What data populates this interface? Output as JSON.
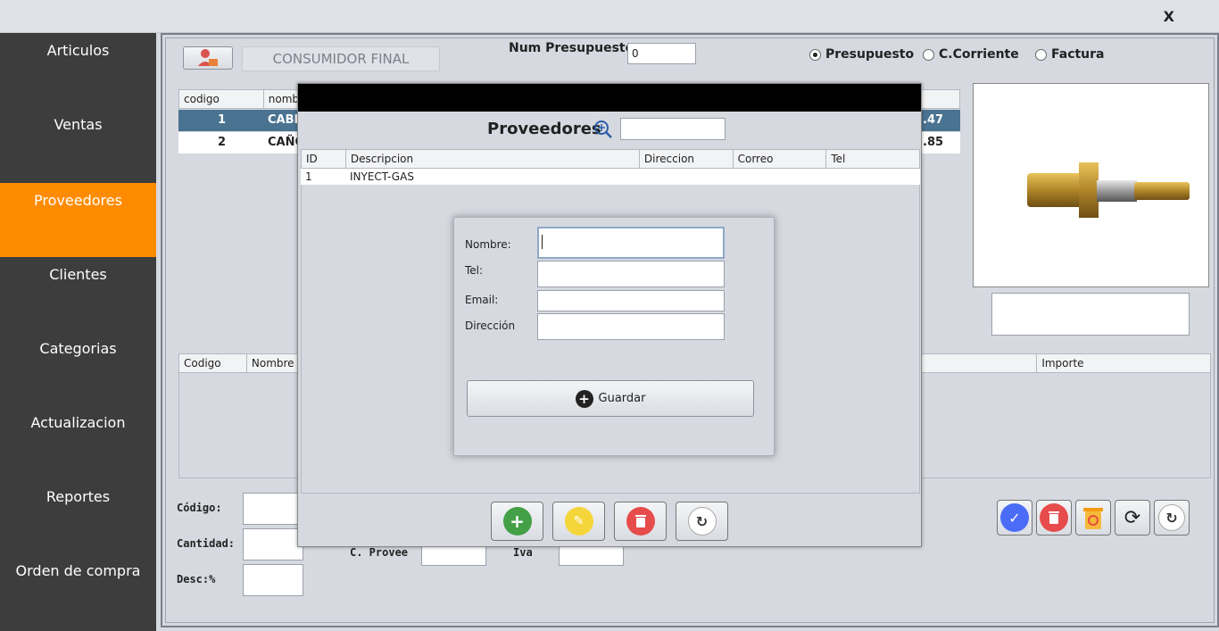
{
  "window": {
    "close_label": "X"
  },
  "sidebar": {
    "items": [
      {
        "label": "Articulos",
        "active": false
      },
      {
        "label": "Ventas",
        "active": false
      },
      {
        "label": "Proveedores",
        "active": true
      },
      {
        "label": "Clientes",
        "active": false
      },
      {
        "label": "Categorias",
        "active": false
      },
      {
        "label": "Actualizacion",
        "active": false
      },
      {
        "label": "Reportes",
        "active": false
      },
      {
        "label": "Orden de compra",
        "active": false
      }
    ],
    "active_color": "#ff8c00"
  },
  "header": {
    "customer_name": "CONSUMIDOR FINAL",
    "num_presupuesto_label": "Num Presupuesto",
    "num_presupuesto_value": "0",
    "doc_types": [
      {
        "label": "Presupuesto",
        "selected": true
      },
      {
        "label": "C.Corriente",
        "selected": false
      },
      {
        "label": "Factura",
        "selected": false
      }
    ]
  },
  "top_table": {
    "columns": [
      "codigo",
      "nomb"
    ],
    "rows": [
      {
        "codigo": "1",
        "nombre": "CABE",
        "price": ".47",
        "selected": true
      },
      {
        "codigo": "2",
        "nombre": "CAÑO",
        "price": ".85",
        "selected": false
      }
    ]
  },
  "bottom_table": {
    "columns": [
      "Codigo",
      "Nombre",
      "Importe"
    ]
  },
  "form": {
    "codigo_label": "Código:",
    "cantidad_label": "Cantidad:",
    "desc_label": "Desc:%",
    "c_provee_label": "C. Provee",
    "iva_label": "Iva"
  },
  "modal": {
    "title": "Proveedores",
    "search_value": "",
    "columns": [
      "ID",
      "Descripcion",
      "Direccion",
      "Correo",
      "Tel"
    ],
    "rows": [
      {
        "id": "1",
        "descripcion": "INYECT-GAS",
        "direccion": "",
        "correo": "",
        "tel": ""
      }
    ]
  },
  "dialog": {
    "nombre_label": "Nombre:",
    "tel_label": "Tel:",
    "email_label": "Email:",
    "direccion_label": "Dirección",
    "save_label": "Guardar"
  },
  "colors": {
    "selected_row": "#4a7391",
    "add_green": "#43a047",
    "edit_yellow": "#f5d63a",
    "delete_red": "#e74c4c",
    "confirm_blue": "#4a6cf7"
  }
}
